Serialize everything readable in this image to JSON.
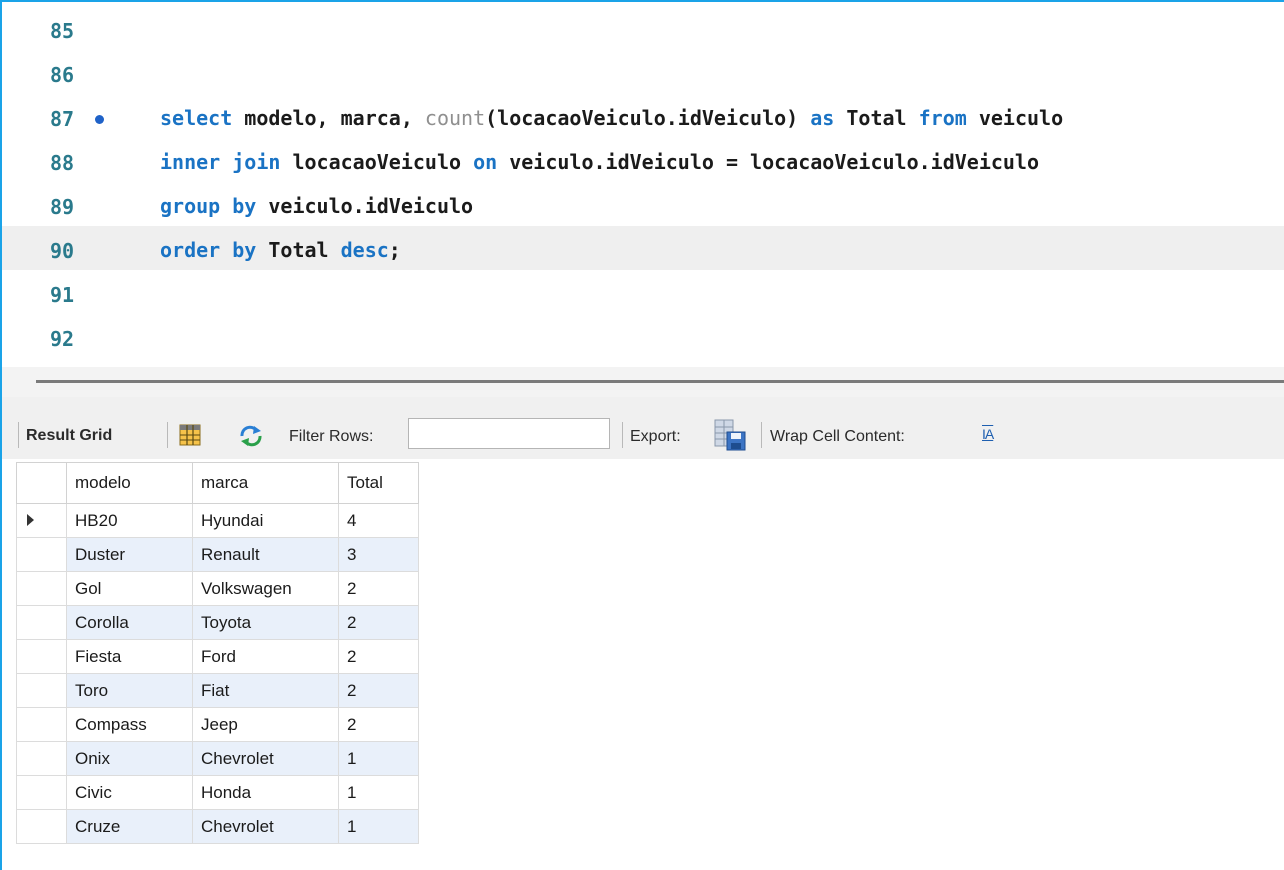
{
  "editor": {
    "lines": [
      {
        "number": "85",
        "text": ""
      },
      {
        "number": "86",
        "text": ""
      },
      {
        "number": "87",
        "text": "select modelo, marca, count(locacaoVeiculo.idVeiculo) as Total from veiculo"
      },
      {
        "number": "88",
        "text": "inner join locacaoVeiculo on veiculo.idVeiculo = locacaoVeiculo.idVeiculo"
      },
      {
        "number": "89",
        "text": "group by veiculo.idVeiculo"
      },
      {
        "number": "90",
        "text": "order by Total desc;"
      },
      {
        "number": "91",
        "text": ""
      },
      {
        "number": "92",
        "text": ""
      }
    ],
    "current_line": "90",
    "breakpoint_line": "87"
  },
  "toolbar": {
    "result_grid_label": "Result Grid",
    "filter_rows_label": "Filter Rows:",
    "filter_value": "",
    "export_label": "Export:",
    "wrap_label": "Wrap Cell Content:",
    "wrap_icon_text": "IA"
  },
  "grid": {
    "columns": [
      "modelo",
      "marca",
      "Total"
    ],
    "rows": [
      [
        "HB20",
        "Hyundai",
        "4"
      ],
      [
        "Duster",
        "Renault",
        "3"
      ],
      [
        "Gol",
        "Volkswagen",
        "2"
      ],
      [
        "Corolla",
        "Toyota",
        "2"
      ],
      [
        "Fiesta",
        "Ford",
        "2"
      ],
      [
        "Toro",
        "Fiat",
        "2"
      ],
      [
        "Compass",
        "Jeep",
        "2"
      ],
      [
        "Onix",
        "Chevrolet",
        "1"
      ],
      [
        "Civic",
        "Honda",
        "1"
      ],
      [
        "Cruze",
        "Chevrolet",
        "1"
      ]
    ],
    "selected_row": 0
  },
  "colors": {
    "frame": "#1aa3e8",
    "keyword": "#1a73c4",
    "function": "#8f8f8f",
    "line_number": "#2a7a8c",
    "alt_row": "#e9f0fa"
  }
}
